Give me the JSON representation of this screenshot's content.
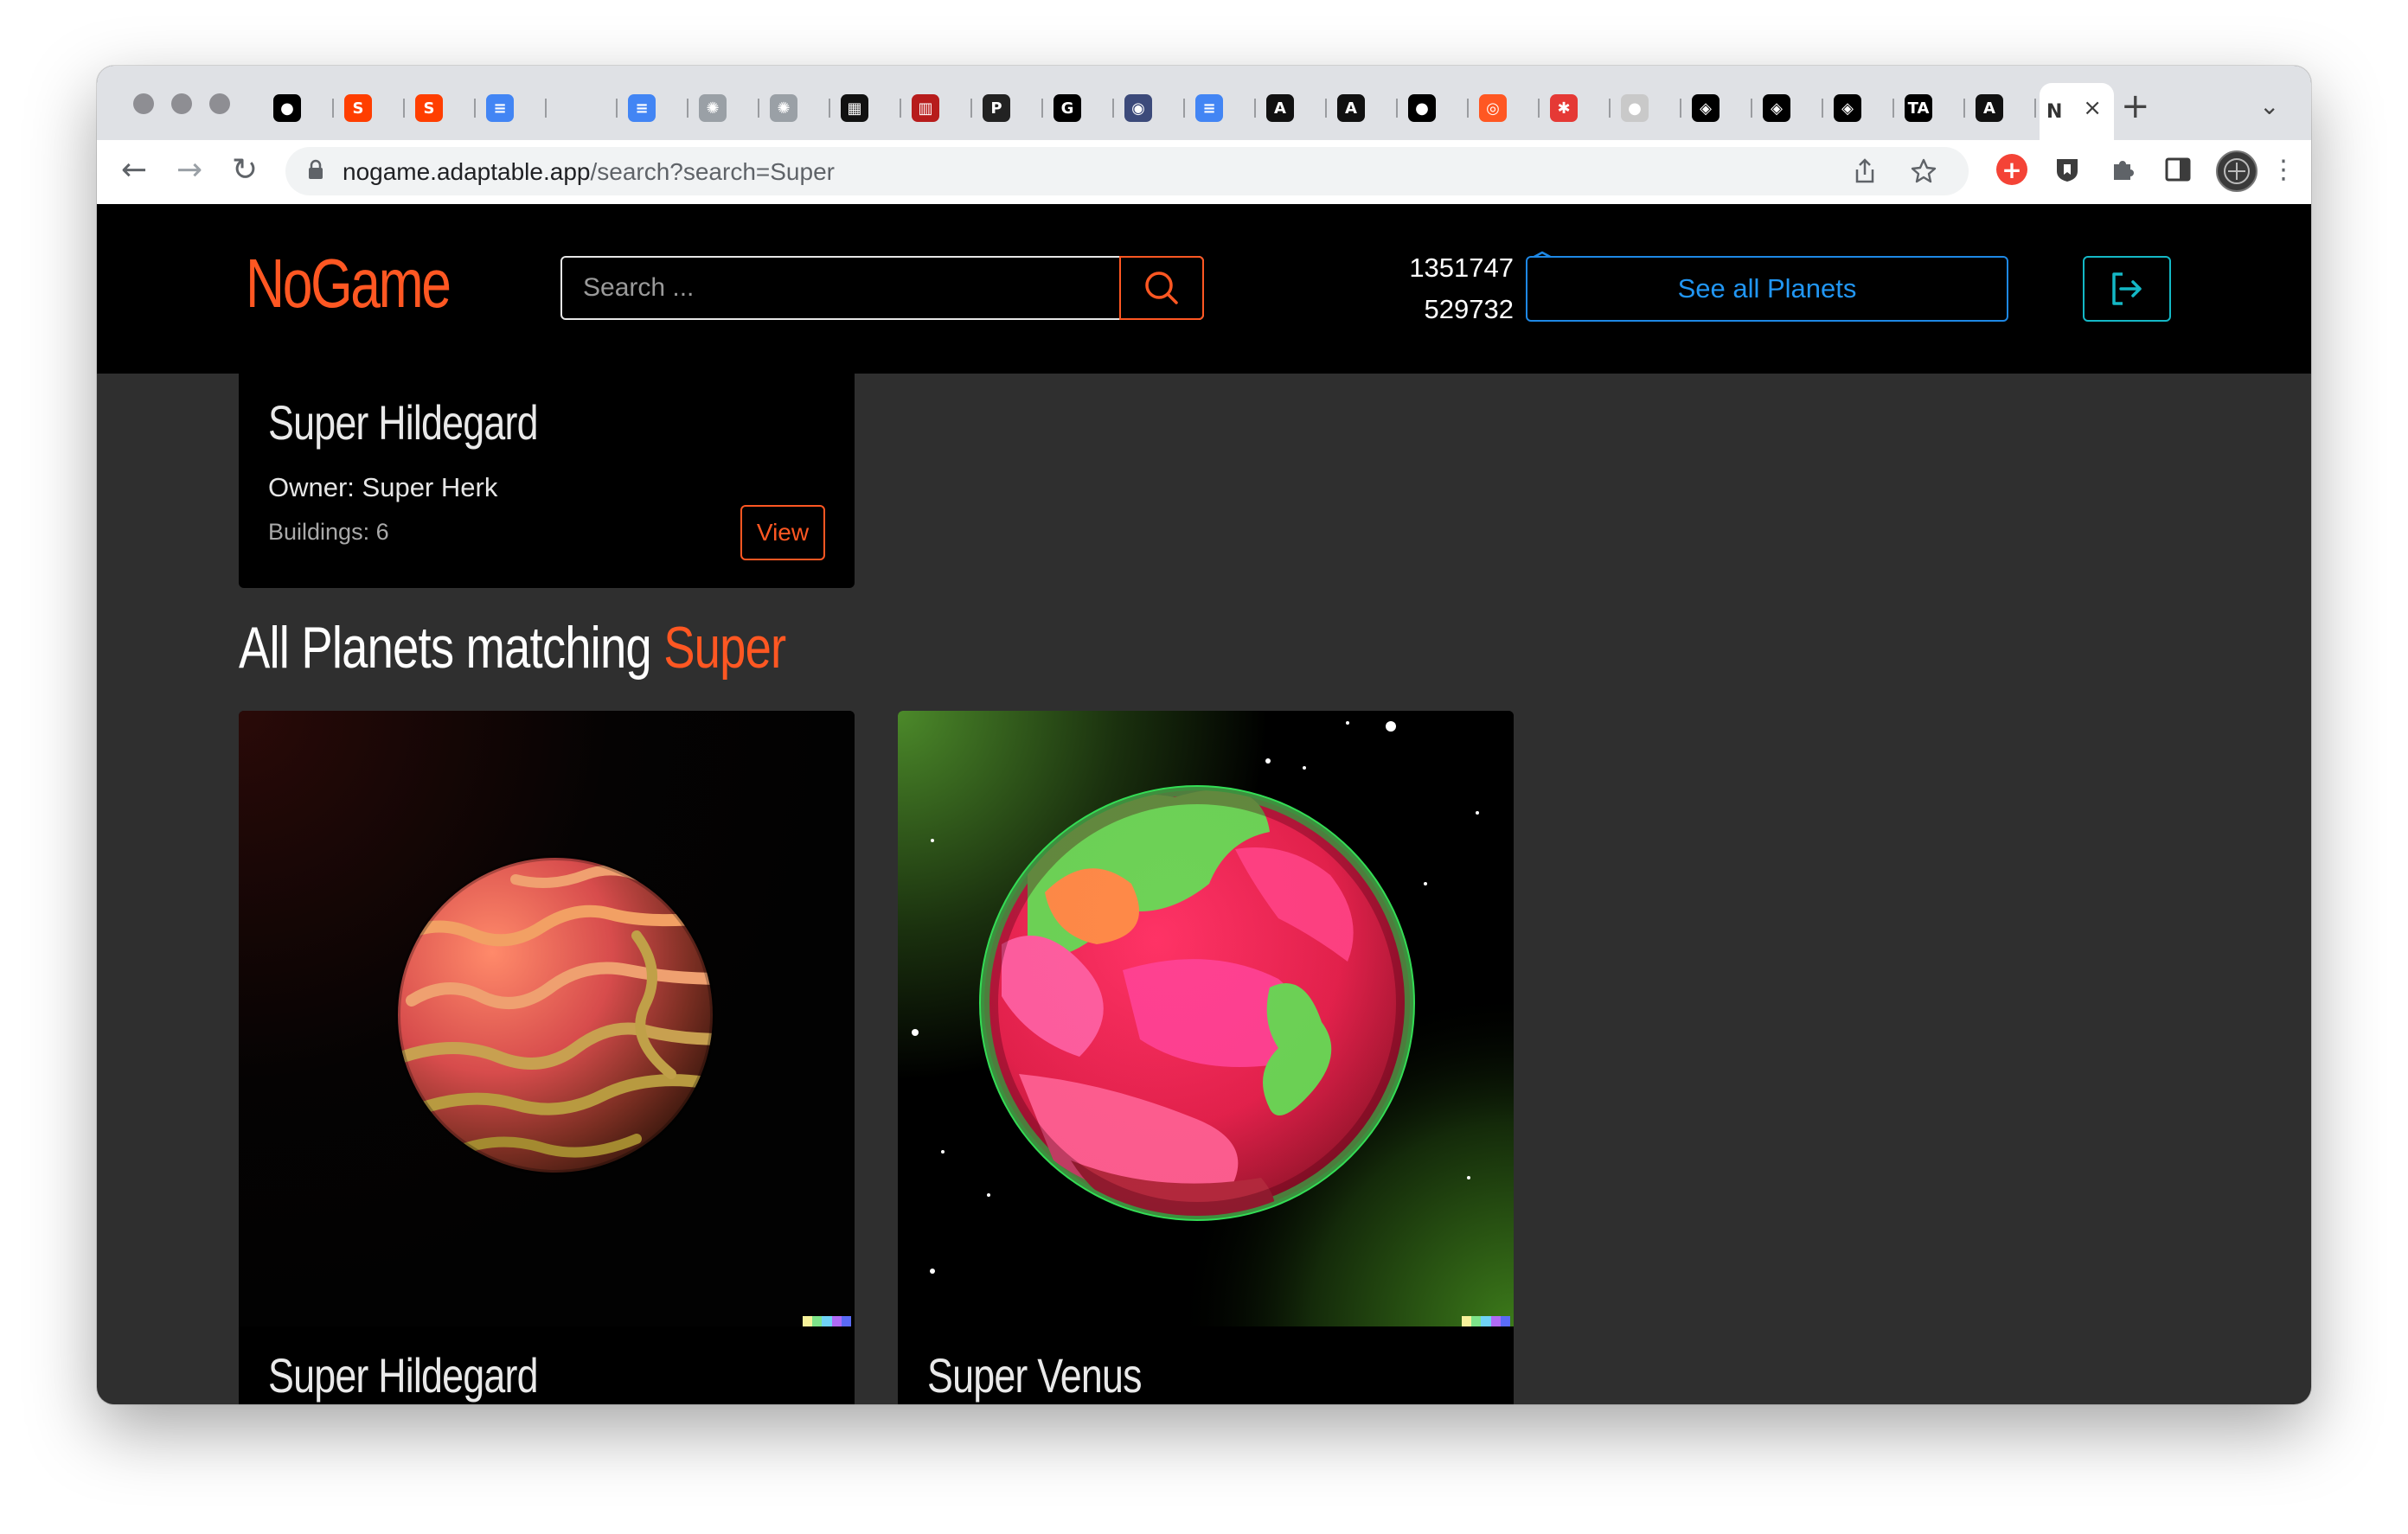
{
  "browser": {
    "tabs": [
      {
        "icon": "medium-icon",
        "color": "#000000",
        "glyph": "●"
      },
      {
        "icon": "svelte-icon",
        "color": "#ff3e00",
        "glyph": "S"
      },
      {
        "icon": "svelte-icon",
        "color": "#ff3e00",
        "glyph": "S"
      },
      {
        "icon": "google-docs-icon",
        "color": "#4285f4",
        "glyph": "≡"
      },
      {
        "icon": "blank-tab-icon",
        "color": "#dfe1e5",
        "glyph": ""
      },
      {
        "icon": "google-docs-icon",
        "color": "#4285f4",
        "glyph": "≡"
      },
      {
        "icon": "dots-icon",
        "color": "#9aa0a6",
        "glyph": "✺"
      },
      {
        "icon": "dots-icon",
        "color": "#9aa0a6",
        "glyph": "✺"
      },
      {
        "icon": "dev-icon",
        "color": "#111111",
        "glyph": "▦"
      },
      {
        "icon": "building-icon",
        "color": "#b71c1c",
        "glyph": "▥"
      },
      {
        "icon": "p-icon",
        "color": "#222222",
        "glyph": "P"
      },
      {
        "icon": "g-icon",
        "color": "#000000",
        "glyph": "G"
      },
      {
        "icon": "brain-icon",
        "color": "#3c4a7a",
        "glyph": "◉"
      },
      {
        "icon": "google-docs-icon",
        "color": "#4285f4",
        "glyph": "≡"
      },
      {
        "icon": "a-icon",
        "color": "#111111",
        "glyph": "A"
      },
      {
        "icon": "a-icon",
        "color": "#111111",
        "glyph": "A"
      },
      {
        "icon": "github-icon",
        "color": "#000000",
        "glyph": "●"
      },
      {
        "icon": "ring-icon",
        "color": "#ff5722",
        "glyph": "◎"
      },
      {
        "icon": "asterisk-icon",
        "color": "#e53935",
        "glyph": "✱"
      },
      {
        "icon": "circle-icon",
        "color": "#c9c9c9",
        "glyph": "●"
      },
      {
        "icon": "codepen-icon",
        "color": "#000000",
        "glyph": "◈"
      },
      {
        "icon": "codepen-icon",
        "color": "#000000",
        "glyph": "◈"
      },
      {
        "icon": "codepen-icon",
        "color": "#000000",
        "glyph": "◈"
      },
      {
        "icon": "ta-icon",
        "color": "#000000",
        "glyph": "TA"
      },
      {
        "icon": "a-icon",
        "color": "#111111",
        "glyph": "A"
      }
    ],
    "active_tab": {
      "icon": "nogame-icon",
      "glyph": "N",
      "close": "×"
    },
    "new_tab": "+",
    "tab_list": "⌄",
    "url_host": "nogame.adaptable.app",
    "url_path": "/search?search=Super",
    "back": "←",
    "forward": "→",
    "reload": "↻"
  },
  "app": {
    "logo": "NoGame",
    "search_placeholder": "Search ...",
    "resource_1": "1351747",
    "resource_2": "529732",
    "see_all_planets": "See all Planets"
  },
  "top_card": {
    "title": "Super Hildegard",
    "owner": "Owner: Super Herk",
    "buildings": "Buildings: 6",
    "view": "View"
  },
  "section": {
    "title_prefix": "All Planets matching",
    "query": "Super"
  },
  "planets": [
    {
      "name": "Super Hildegard"
    },
    {
      "name": "Super Venus"
    }
  ],
  "colors": {
    "accent": "#ff5722",
    "link_blue": "#2196f3",
    "teal": "#14b8c6",
    "header_bg": "#000000",
    "page_bg": "#2f2f2f"
  }
}
